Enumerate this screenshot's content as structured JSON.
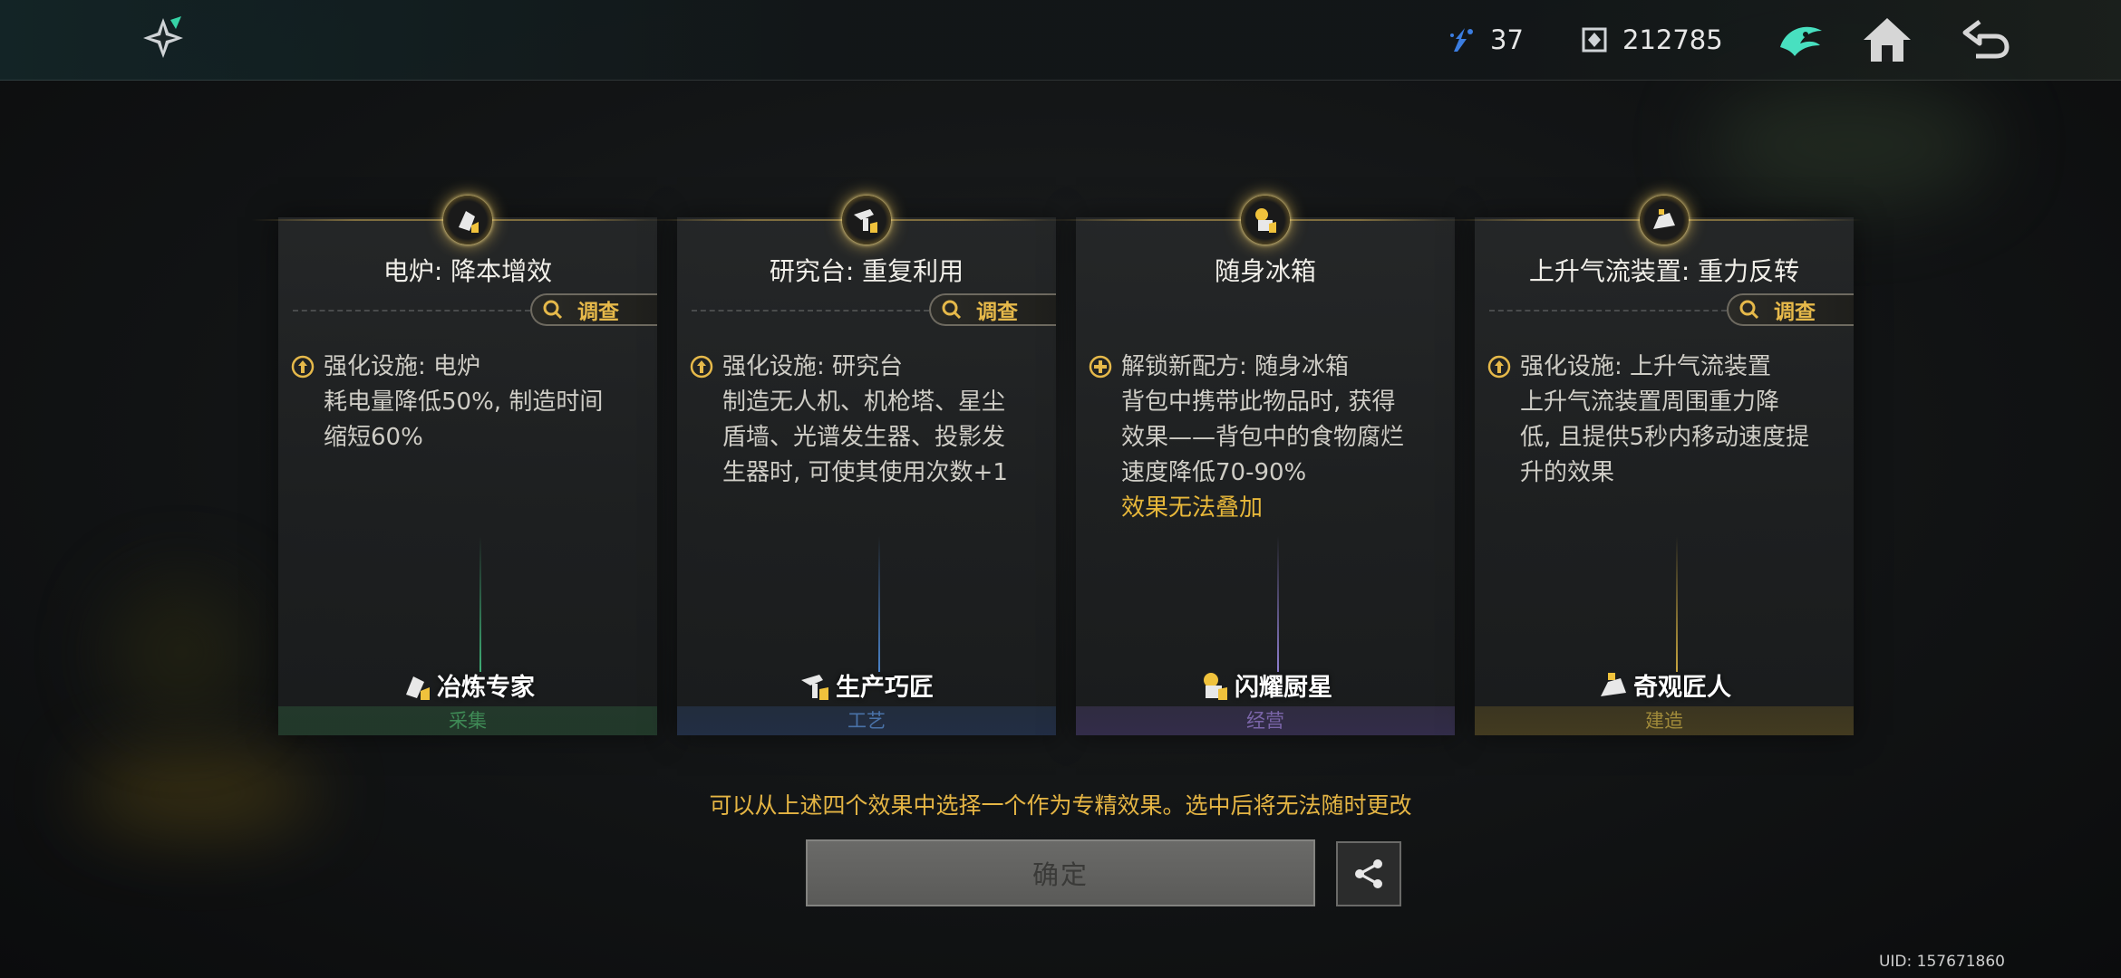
{
  "topbar": {
    "resource1": {
      "icon": "energy-shard-icon",
      "value": "37"
    },
    "resource2": {
      "icon": "currency-cube-icon",
      "value": "212785"
    },
    "nav": [
      "faction-emblem-icon",
      "home-icon",
      "back-icon"
    ]
  },
  "cards": [
    {
      "title": "电炉: 降本增效",
      "investigate": "调查",
      "desc_icon": "upgrade-icon",
      "desc_head": "强化设施: 电炉",
      "desc_lines": [
        "耗电量降低50%, 制造时间",
        "缩短60%"
      ],
      "warn": "",
      "specialist": "冶炼专家",
      "category": "采集",
      "category_color": "#3f8b56"
    },
    {
      "title": "研究台: 重复利用",
      "investigate": "调查",
      "desc_icon": "upgrade-icon",
      "desc_head": "强化设施: 研究台",
      "desc_lines": [
        "制造无人机、机枪塔、星尘",
        "盾墙、光谱发生器、投影发",
        "生器时, 可使其使用次数+1"
      ],
      "warn": "",
      "specialist": "生产巧匠",
      "category": "工艺",
      "category_color": "#4a72a8"
    },
    {
      "title": "随身冰箱",
      "investigate": "",
      "desc_icon": "unlock-recipe-icon",
      "desc_head": "解锁新配方: 随身冰箱",
      "desc_lines": [
        "背包中携带此物品时, 获得",
        "效果——背包中的食物腐烂",
        "速度降低70-90%"
      ],
      "warn": "效果无法叠加",
      "specialist": "闪耀厨星",
      "category": "经营",
      "category_color": "#7a65a8"
    },
    {
      "title": "上升气流装置: 重力反转",
      "investigate": "调查",
      "desc_icon": "upgrade-icon",
      "desc_head": "强化设施: 上升气流装置",
      "desc_lines": [
        "上升气流装置周围重力降",
        "低, 且提供5秒内移动速度提",
        "升的效果"
      ],
      "warn": "",
      "specialist": "奇观匠人",
      "category": "建造",
      "category_color": "#a08a3a"
    }
  ],
  "hint": "可以从上述四个效果中选择一个作为专精效果。选中后将无法随时更改",
  "confirm_label": "确定",
  "uid": "UID: 157671860"
}
